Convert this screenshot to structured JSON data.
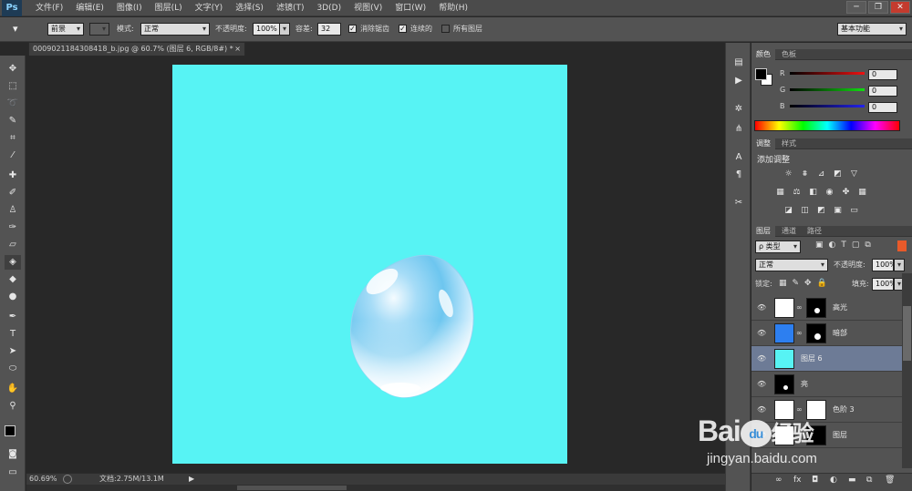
{
  "app": {
    "logo": "Ps"
  },
  "menu": [
    "文件(F)",
    "编辑(E)",
    "图像(I)",
    "图层(L)",
    "文字(Y)",
    "选择(S)",
    "滤镜(T)",
    "3D(D)",
    "视图(V)",
    "窗口(W)",
    "帮助(H)"
  ],
  "window_controls": [
    "─",
    "❐",
    "✕"
  ],
  "options": {
    "fill_source": "前景",
    "mode_label": "模式:",
    "mode_value": "正常",
    "opacity_label": "不透明度:",
    "opacity_value": "100%",
    "tolerance_label": "容差:",
    "tolerance_value": "32",
    "antialias_label": "消除锯齿",
    "contiguous_label": "连续的",
    "all_layers_label": "所有图层",
    "workspace": "基本功能"
  },
  "document": {
    "tab_title": "0009021184308418_b.jpg @ 60.7% (图层 6, RGB/8#) *",
    "tab_close": "×"
  },
  "status": {
    "zoom": "60.69%",
    "doc_info": "文档:2.75M/13.1M"
  },
  "color_panel": {
    "tabs": [
      "颜色",
      "色板"
    ],
    "channels": [
      {
        "name": "R",
        "value": "0"
      },
      {
        "name": "G",
        "value": "0"
      },
      {
        "name": "B",
        "value": "0"
      }
    ]
  },
  "adjust_panel": {
    "tabs": [
      "调整",
      "样式"
    ],
    "title": "添加调整"
  },
  "layers_panel": {
    "tabs": [
      "图层",
      "通道",
      "路径"
    ],
    "filter_kind": "ρ 类型",
    "blend_mode": "正常",
    "opacity_label": "不透明度:",
    "opacity_value": "100%",
    "lock_label": "锁定:",
    "fill_label": "填充:",
    "fill_value": "100%",
    "layers": [
      {
        "name": "高光",
        "selected": false
      },
      {
        "name": "暗部",
        "selected": false
      },
      {
        "name": "图层 6",
        "selected": true
      },
      {
        "name": "亮",
        "selected": false
      },
      {
        "name": "色阶 3",
        "selected": false
      },
      {
        "name": "图层",
        "selected": false
      }
    ]
  },
  "watermark": {
    "brand": "Bai",
    "brand_du": "du",
    "brand_cn": "经验",
    "url": "jingyan.baidu.com"
  },
  "colors": {
    "canvas": "#57f3f4",
    "ui_dark": "#535353",
    "selected_layer": "#6d7b96"
  }
}
